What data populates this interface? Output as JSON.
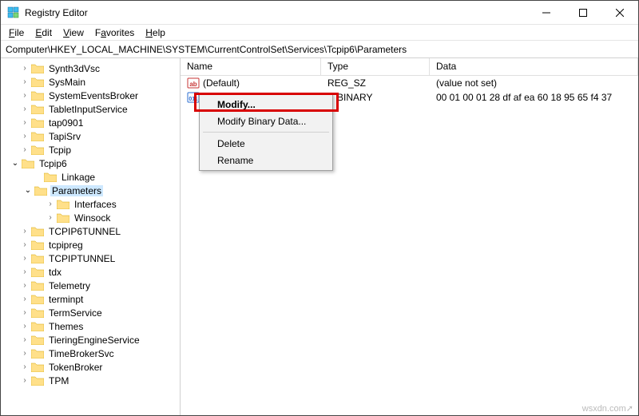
{
  "titlebar": {
    "title": "Registry Editor"
  },
  "menu": {
    "file": "File",
    "edit": "Edit",
    "view": "View",
    "favorites": "Favorites",
    "help": "Help"
  },
  "address": "Computer\\HKEY_LOCAL_MACHINE\\SYSTEM\\CurrentControlSet\\Services\\Tcpip6\\Parameters",
  "tree": {
    "items": [
      {
        "label": "Synth3dVsc"
      },
      {
        "label": "SysMain"
      },
      {
        "label": "SystemEventsBroker"
      },
      {
        "label": "TabletInputService"
      },
      {
        "label": "tap0901"
      },
      {
        "label": "TapiSrv"
      },
      {
        "label": "Tcpip"
      },
      {
        "label": "Tcpip6"
      },
      {
        "label": "Linkage"
      },
      {
        "label": "Parameters"
      },
      {
        "label": "Interfaces"
      },
      {
        "label": "Winsock"
      },
      {
        "label": "TCPIP6TUNNEL"
      },
      {
        "label": "tcpipreg"
      },
      {
        "label": "TCPIPTUNNEL"
      },
      {
        "label": "tdx"
      },
      {
        "label": "Telemetry"
      },
      {
        "label": "terminpt"
      },
      {
        "label": "TermService"
      },
      {
        "label": "Themes"
      },
      {
        "label": "TieringEngineService"
      },
      {
        "label": "TimeBrokerSvc"
      },
      {
        "label": "TokenBroker"
      },
      {
        "label": "TPM"
      }
    ]
  },
  "columns": {
    "name": "Name",
    "type": "Type",
    "data": "Data"
  },
  "values": [
    {
      "name": "(Default)",
      "type": "REG_SZ",
      "data": "(value not set)"
    },
    {
      "name": "",
      "type": "BINARY",
      "data": "00 01 00 01 28 df af ea 60 18 95 65 f4 37"
    }
  ],
  "context": {
    "modify": "Modify...",
    "modify_binary": "Modify Binary Data...",
    "delete": "Delete",
    "rename": "Rename"
  },
  "watermark": "wsxdn.com"
}
